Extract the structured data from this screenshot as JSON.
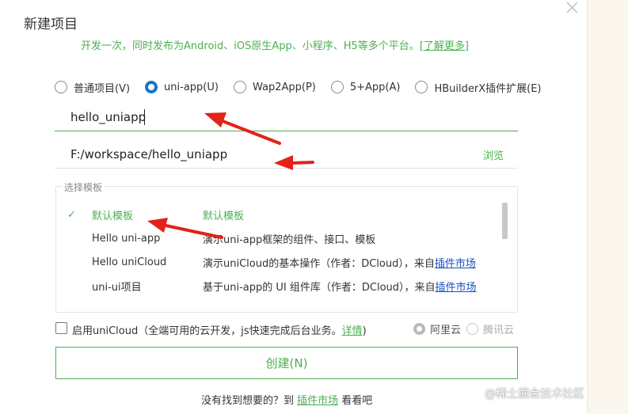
{
  "dialog": {
    "title": "新建项目",
    "subtitle_text": "开发一次，同时发布为Android、iOS原生App、小程序、H5等多个平台。",
    "subtitle_link": "[了解更多]"
  },
  "project_types": [
    {
      "label": "普通项目(V)",
      "checked": false
    },
    {
      "label": "uni-app(U)",
      "checked": true
    },
    {
      "label": "Wap2App(P)",
      "checked": false
    },
    {
      "label": "5+App(A)",
      "checked": false
    },
    {
      "label": "HBuilderX插件扩展(E)",
      "checked": false
    }
  ],
  "project_name": "hello_uniapp",
  "project_path": "F:/workspace/hello_uniapp",
  "browse_label": "浏览",
  "templates": {
    "legend": "选择模板",
    "rows": [
      {
        "check": "✓",
        "name": "默认模板",
        "desc": "默认模板",
        "link": ""
      },
      {
        "check": "",
        "name": "Hello uni-app",
        "desc": "演示uni-app框架的组件、接口、模板",
        "link": ""
      },
      {
        "check": "",
        "name": "Hello uniCloud",
        "desc": "演示uniCloud的基本操作（作者：DCloud），来自",
        "link": "插件市场"
      },
      {
        "check": "",
        "name": "uni-ui项目",
        "desc": "基于uni-app的 UI 组件库（作者：DCloud），来自",
        "link": "插件市场"
      }
    ]
  },
  "unicloud": {
    "text": "启用uniCloud（全端可用的云开发，js快速完成后台业务。",
    "link": "详情",
    "suffix": ")",
    "providers": [
      {
        "label": "阿里云",
        "checked": true
      },
      {
        "label": "腾讯云",
        "checked": false
      }
    ]
  },
  "create_button": "创建(N)",
  "footer": {
    "prefix": "没有找到想要的？到 ",
    "link": "插件市场",
    "suffix": " 看看吧"
  },
  "watermark": "@稀土掘金技术社区",
  "colors": {
    "accent_green": "#4cb050",
    "radio_blue": "#1a73c7",
    "annotation_red": "#e32219",
    "link_blue": "#1a4fc4"
  },
  "icons": [
    "close-icon",
    "check-icon",
    "annotation-arrow"
  ]
}
